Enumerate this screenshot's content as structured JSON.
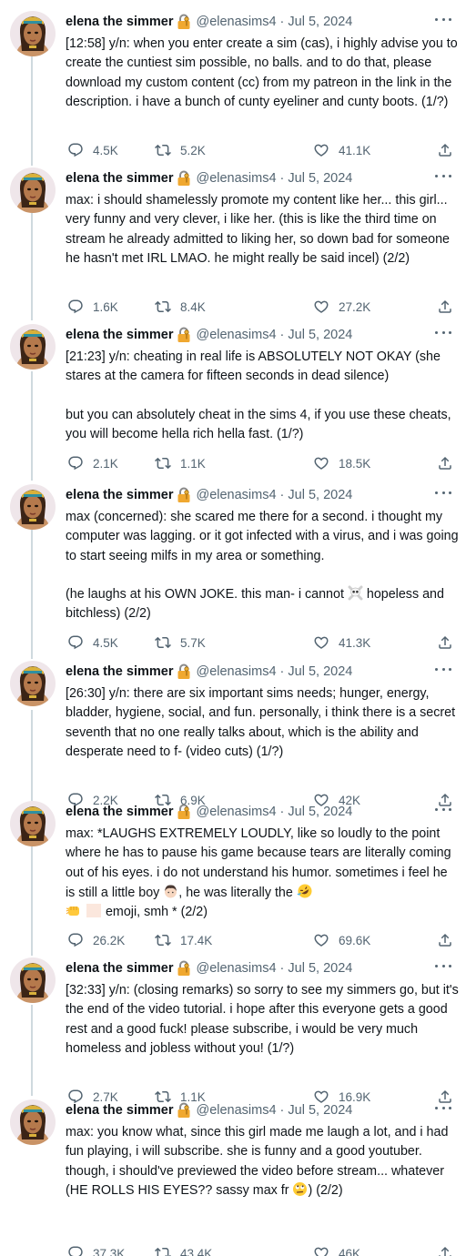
{
  "author": {
    "name": "elena the simmer",
    "handle": "@elenasims4",
    "separator": "·",
    "date": "Jul 5, 2024"
  },
  "icons": {
    "reply": "reply-icon",
    "retweet": "retweet-icon",
    "like": "like-icon",
    "share": "share-icon",
    "lock": "lock-key-emoji-icon",
    "more": "more-icon"
  },
  "colors": {
    "text": "#0f1419",
    "secondary": "#536471",
    "thread_line": "#cfd9de"
  },
  "tweets": [
    {
      "text": [
        "[12:58] y/n: when you enter create a sim (cas), i highly advise you to create the cuntiest sim possible, no balls. and to do that, please download my custom content (cc) from my patreon in the link in the description. i have a bunch of cunty eyeliner and cunty boots. (1/?)"
      ],
      "replies": "4.5K",
      "retweets": "5.2K",
      "likes": "41.1K"
    },
    {
      "text": [
        "max: i should shamelessly promote my content like her... this girl... very funny and very clever, i like her. (this is like the third time on stream he already admitted to liking her, so down bad for someone he hasn't met IRL LMAO. he might really be said incel) (2/2)"
      ],
      "replies": "1.6K",
      "retweets": "8.4K",
      "likes": "27.2K"
    },
    {
      "text": [
        "[21:23] y/n: cheating in real life is ABSOLUTELY NOT OKAY (she stares at the camera for fifteen seconds in dead silence)",
        "but you can absolutely cheat in the sims 4, if you use these cheats, you will become hella rich hella fast. (1/?)"
      ],
      "replies": "2.1K",
      "retweets": "1.1K",
      "likes": "18.5K"
    },
    {
      "text": [
        "max (concerned): she scared me there for a second. i thought my computer was lagging. or it got infected with a virus, and i was going to start seeing milfs in my area or something."
      ],
      "text2_a": "(he laughs at his OWN JOKE. this man- i cannot ",
      "text2_emoji": "skull-crossbones-emoji",
      "text2_b": " hopeless and bitchless) (2/2)",
      "replies": "4.5K",
      "retweets": "5.7K",
      "likes": "41.3K"
    },
    {
      "text": [
        "[26:30] y/n: there are six important sims needs; hunger, energy, bladder, hygiene, social, and fun. personally, i think there is a secret seventh that no one really talks about, which is the ability and desperate need to f- (video cuts) (1/?)"
      ],
      "replies": "2.2K",
      "retweets": "6.9K",
      "likes": "42K"
    },
    {
      "text_a": "max: *LAUGHS EXTREMELY LOUDLY, like so loudly to the point where he has to pause his game because tears are literally coming out of his eyes. i do not understand his humor. sometimes i feel he is still a little boy ",
      "emoji_1": "boy-emoji",
      "text_b": ", he was literally the ",
      "emoji_2": "rolling-laughing-emoji",
      "emoji_3": "fist-emoji",
      "emoji_4": "skin-tone-swatch",
      "text_c": " emoji, smh * (2/2)",
      "replies": "26.2K",
      "retweets": "17.4K",
      "likes": "69.6K"
    },
    {
      "text": [
        "[32:33] y/n: (closing remarks) so sorry to see my simmers go, but it's the end of the video tutorial. i hope after this everyone gets a good rest and a good fuck! please subscribe, i would be very much homeless and jobless without you! (1/?)"
      ],
      "replies": "2.7K",
      "retweets": "1.1K",
      "likes": "16.9K"
    },
    {
      "text_a": "max: you know what, since this girl made me laugh a lot, and i had fun playing, i will subscribe. she is funny and a good youtuber. though, i should've previewed the video before stream... whatever (HE ROLLS HIS EYES?? sassy max fr ",
      "emoji_1": "rolling-eyes-emoji",
      "text_b": ") (2/2)",
      "replies": "37.3K",
      "retweets": "43.4K",
      "likes": "46K"
    }
  ]
}
